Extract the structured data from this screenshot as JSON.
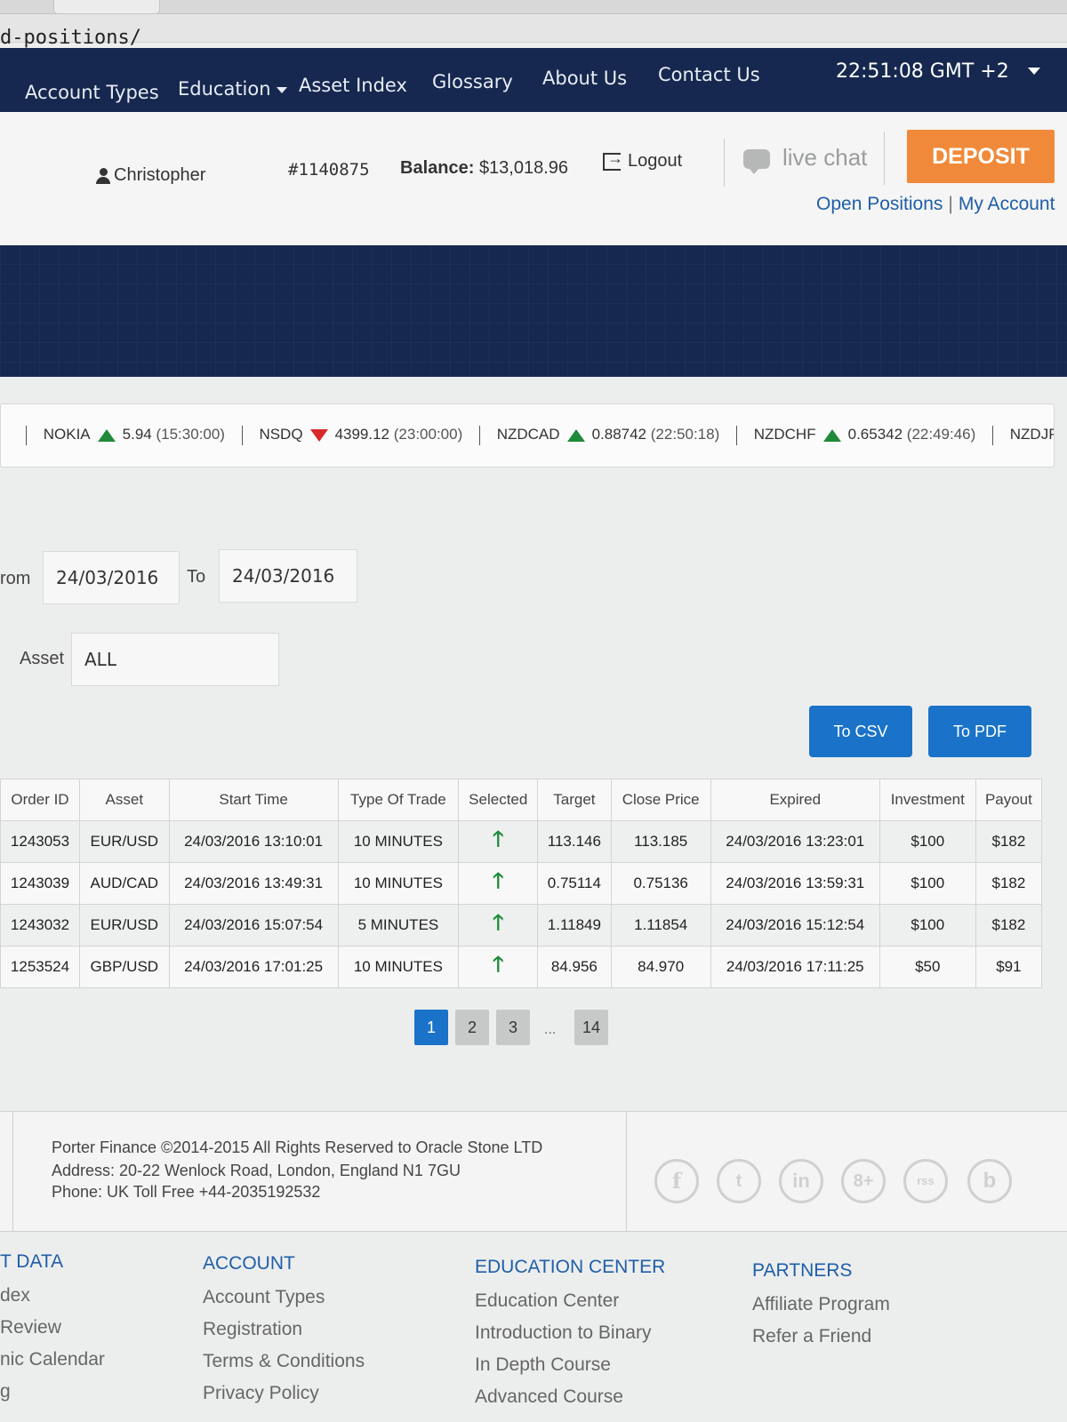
{
  "browser": {
    "url": "d-positions/"
  },
  "nav": {
    "items": [
      "Account Types",
      "Education",
      "Asset Index",
      "Glossary",
      "About Us",
      "Contact Us"
    ],
    "clock": "22:51:08 GMT +2"
  },
  "user": {
    "name": "Christopher",
    "account_id": "#1140875",
    "balance_label": "Balance:",
    "balance": "$13,018.96",
    "logout": "Logout",
    "live_chat": "live chat",
    "deposit": "DEPOSIT",
    "open_positions": "Open Positions",
    "separator": "|",
    "my_account": "My Account"
  },
  "ticker": [
    {
      "symbol": "NOKIA",
      "dir": "up",
      "value": "5.94",
      "time": "(15:30:00)"
    },
    {
      "symbol": "NSDQ",
      "dir": "down",
      "value": "4399.12",
      "time": "(23:00:00)"
    },
    {
      "symbol": "NZDCAD",
      "dir": "up",
      "value": "0.88742",
      "time": "(22:50:18)"
    },
    {
      "symbol": "NZDCHF",
      "dir": "up",
      "value": "0.65342",
      "time": "(22:49:46)"
    },
    {
      "symbol": "NZDJPY",
      "dir": "up",
      "value": "",
      "time": ""
    }
  ],
  "filters": {
    "from_label": "rom",
    "from_value": "24/03/2016",
    "to_label": "To",
    "to_value": "24/03/2016",
    "asset_label": "Asset",
    "asset_value": "ALL"
  },
  "buttons": {
    "csv": "To CSV",
    "pdf": "To PDF"
  },
  "table": {
    "headers": [
      "Order ID",
      "Asset",
      "Start Time",
      "Type Of Trade",
      "Selected",
      "Target",
      "Close Price",
      "Expired",
      "Investment",
      "Payout"
    ],
    "rows": [
      [
        "1243053",
        "EUR/USD",
        "24/03/2016 13:10:01",
        "10 MINUTES",
        "up",
        "113.146",
        "113.185",
        "24/03/2016 13:23:01",
        "$100",
        "$182"
      ],
      [
        "1243039",
        "AUD/CAD",
        "24/03/2016 13:49:31",
        "10 MINUTES",
        "up",
        "0.75114",
        "0.75136",
        "24/03/2016 13:59:31",
        "$100",
        "$182"
      ],
      [
        "1243032",
        "EUR/USD",
        "24/03/2016 15:07:54",
        "5 MINUTES",
        "up",
        "1.11849",
        "1.11854",
        "24/03/2016 15:12:54",
        "$100",
        "$182"
      ],
      [
        "1253524",
        "GBP/USD",
        "24/03/2016 17:01:25",
        "10 MINUTES",
        "up",
        "84.956",
        "84.970",
        "24/03/2016 17:11:25",
        "$50",
        "$91"
      ]
    ]
  },
  "pagination": {
    "pages": [
      "1",
      "2",
      "3",
      "14"
    ],
    "dots": "...",
    "active": "1"
  },
  "footer": {
    "line1": "Porter Finance ©2014-2015 All Rights Reserved to Oracle Stone LTD",
    "line2": "Address: 20-22 Wenlock Road, London, England N1 7GU",
    "line3": "Phone: UK Toll Free +44-2035192532",
    "social": [
      "f",
      "t",
      "in",
      "8+",
      "rss",
      "b"
    ],
    "columns": [
      {
        "title": "T DATA",
        "items": [
          "dex",
          "Review",
          "nic Calendar",
          "g"
        ]
      },
      {
        "title": "ACCOUNT",
        "items": [
          "Account Types",
          "Registration",
          "Terms & Conditions",
          "Privacy Policy"
        ]
      },
      {
        "title": "EDUCATION CENTER",
        "items": [
          "Education Center",
          "Introduction to Binary",
          "In Depth Course",
          "Advanced Course"
        ]
      },
      {
        "title": "PARTNERS",
        "items": [
          "Affiliate Program",
          "Refer a Friend"
        ]
      }
    ]
  },
  "colors": {
    "nav_bg": "#16284f",
    "deposit": "#f08a3a",
    "link": "#1f5ea8",
    "button": "#1a73c8",
    "up": "#1f8a3a",
    "down": "#d72a2a"
  }
}
